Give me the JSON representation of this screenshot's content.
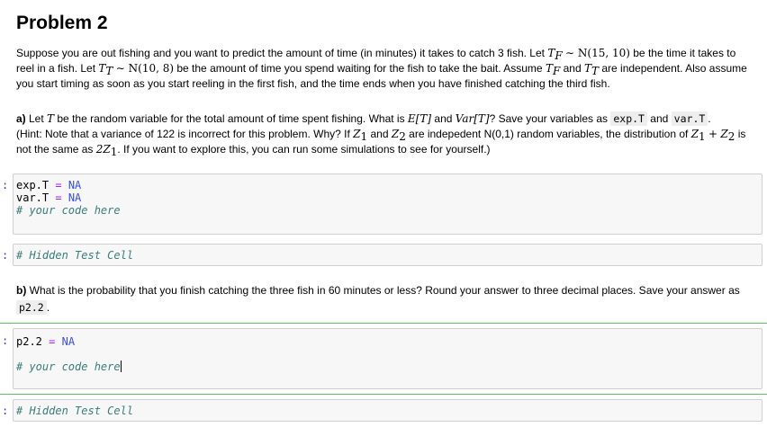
{
  "title": "Problem 2",
  "intro": {
    "l1a": "Suppose you are out fishing and you want to predict the amount of time (in minutes) it takes to catch 3 fish. Let ",
    "l1b": " be the time it takes to",
    "l2a": "reel in a fish. Let ",
    "l2b": " be the amount of time you spend waiting for the fish to take the bait. Assume ",
    "l2c": " and ",
    "l2d": " are independent. Also assume",
    "l3": "you start timing as soon as you start reeling in the first fish, and the time ends when you have finished catching the third fish."
  },
  "math": {
    "TF": "T",
    "F": "F",
    "TT": "T",
    "T": "T",
    "dist_f": "∼ N(15, 10)",
    "dist_t": "∼ N(10, 8)",
    "ET": "E[T]",
    "VarT": "Var[T]",
    "Z": "Z",
    "one": "1",
    "two": "2",
    "sum": "+",
    "twoZ": "2Z"
  },
  "part_a": {
    "label": "a)",
    "t1": " Let ",
    "t2": " be the random variable for the total amount of time spent fishing. What is ",
    "t3": " and ",
    "t4": "? Save your variables as ",
    "var1": "exp.T",
    "t5": " and ",
    "var2": "var.T",
    "t6": ".",
    "h1": "(Hint: Note that a variance of 122 is incorrect for this problem. Why? If ",
    "h2": " and ",
    "h3": " are indepedent N(0,1) random variables, the distribution of ",
    "h4": " is",
    "h5": "not the same as ",
    "h6": ". If you want to explore this, you can run some simulations to see for yourself.)"
  },
  "part_b": {
    "label": "b)",
    "text": " What is the probability that you finish catching the three fish in 60 minutes or less? Round your answer to three decimal places. Save your answer as",
    "var": "p2.2",
    "end": "."
  },
  "cells": {
    "prompt": ":",
    "c1_l1_var": "exp.T",
    "c1_l2_var": "var.T",
    "assign": "=",
    "na": "NA",
    "comment_code": "# your code here",
    "hidden": "# Hidden Test Cell",
    "c3_var": "p2.2"
  }
}
